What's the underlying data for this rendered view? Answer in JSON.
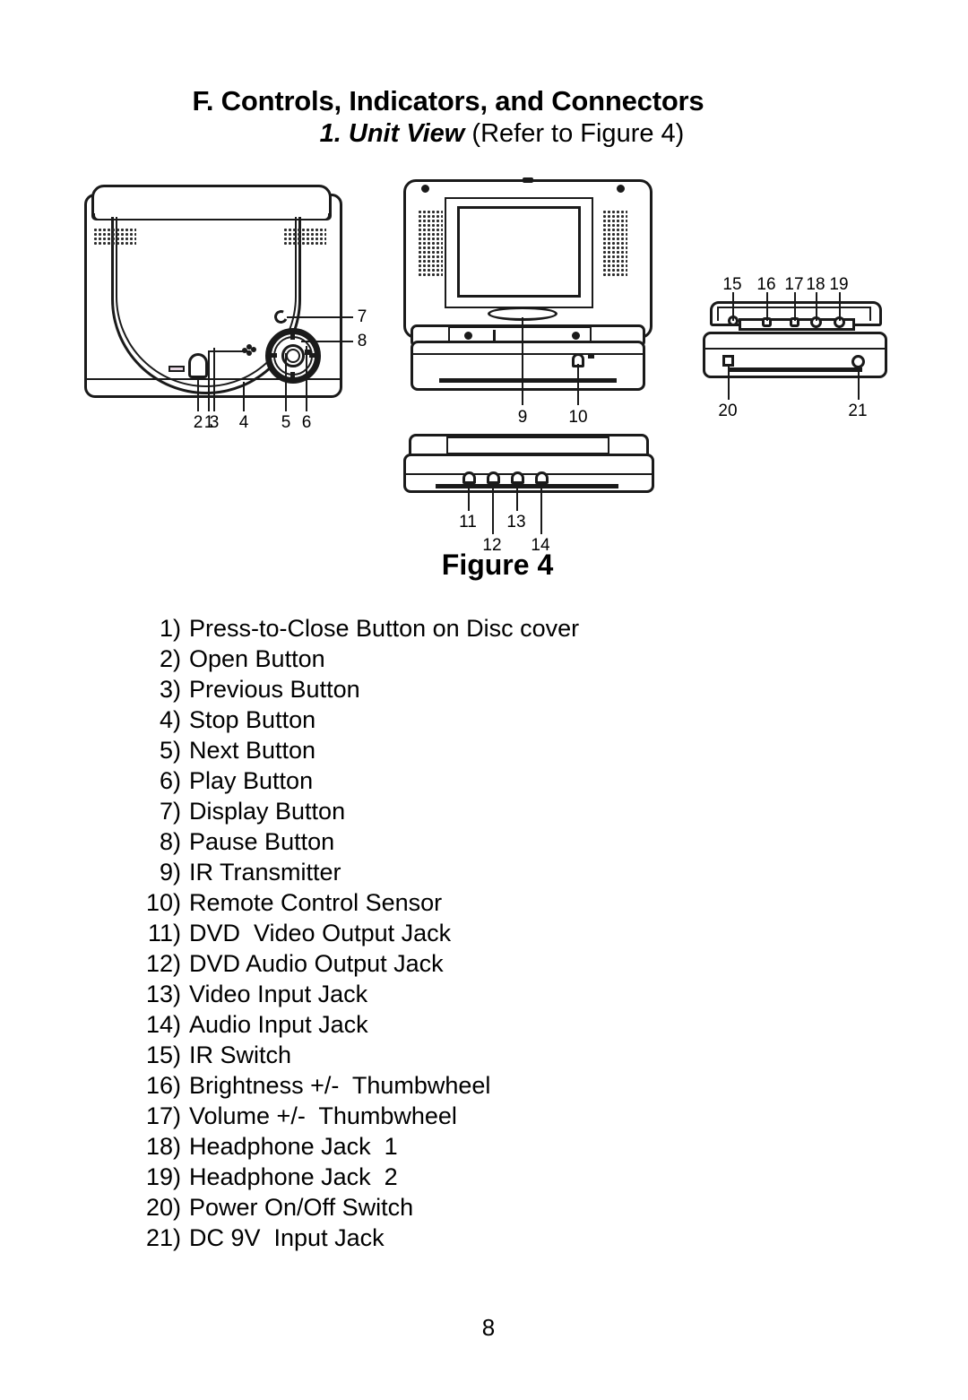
{
  "document": {
    "section_heading": "F. Controls, Indicators, and Connectors",
    "subsection_emphasis": "1. Unit View",
    "subsection_rest": "(Refer to Figure 4)",
    "figure_caption": "Figure 4",
    "page_number": "8"
  },
  "figure": {
    "views": [
      {
        "name": "disc-cover-view",
        "callouts": [
          "1",
          "2",
          "3",
          "4",
          "5",
          "6",
          "7",
          "8"
        ]
      },
      {
        "name": "front-open-view",
        "callouts": [
          "9",
          "10"
        ]
      },
      {
        "name": "rear-jacks-view",
        "callouts": [
          "11",
          "12",
          "13",
          "14"
        ]
      },
      {
        "name": "right-side-view",
        "callouts": [
          "15",
          "16",
          "17",
          "18",
          "19",
          "20",
          "21"
        ]
      }
    ],
    "callout_labels": {
      "c1": "1",
      "c2": "2",
      "c3": "3",
      "c4": "4",
      "c5": "5",
      "c6": "6",
      "c7": "7",
      "c8": "8",
      "c9": "9",
      "c10": "10",
      "c11": "11",
      "c12": "12",
      "c13": "13",
      "c14": "14",
      "c15": "15",
      "c16": "16",
      "c17": "17",
      "c18": "18",
      "c19": "19",
      "c20": "20",
      "c21": "21"
    }
  },
  "items": [
    {
      "num": "1)",
      "text": "Press-to-Close Button on Disc cover"
    },
    {
      "num": "2)",
      "text": "Open Button"
    },
    {
      "num": "3)",
      "text": "Previous Button"
    },
    {
      "num": "4)",
      "text": "Stop Button"
    },
    {
      "num": "5)",
      "text": "Next Button"
    },
    {
      "num": "6)",
      "text": "Play Button"
    },
    {
      "num": "7)",
      "text": "Display Button"
    },
    {
      "num": "8)",
      "text": "Pause Button"
    },
    {
      "num": "9)",
      "text": "IR Transmitter"
    },
    {
      "num": "10)",
      "text": "Remote Control Sensor"
    },
    {
      "num": "11)",
      "text": "DVD  Video Output Jack"
    },
    {
      "num": "12)",
      "text": "DVD Audio Output Jack"
    },
    {
      "num": "13)",
      "text": "Video Input Jack"
    },
    {
      "num": "14)",
      "text": "Audio Input Jack"
    },
    {
      "num": "15)",
      "text": "IR Switch"
    },
    {
      "num": "16)",
      "text": "Brightness +/-  Thumbwheel"
    },
    {
      "num": "17)",
      "text": "Volume +/-  Thumbwheel"
    },
    {
      "num": "18)",
      "text": "Headphone Jack  1"
    },
    {
      "num": "19)",
      "text": "Headphone Jack  2"
    },
    {
      "num": "20)",
      "text": "Power On/Off Switch"
    },
    {
      "num": "21)",
      "text": "DC 9V  Input Jack"
    }
  ],
  "colors": {
    "ink": "#1a1a1a",
    "paper": "#ffffff"
  }
}
